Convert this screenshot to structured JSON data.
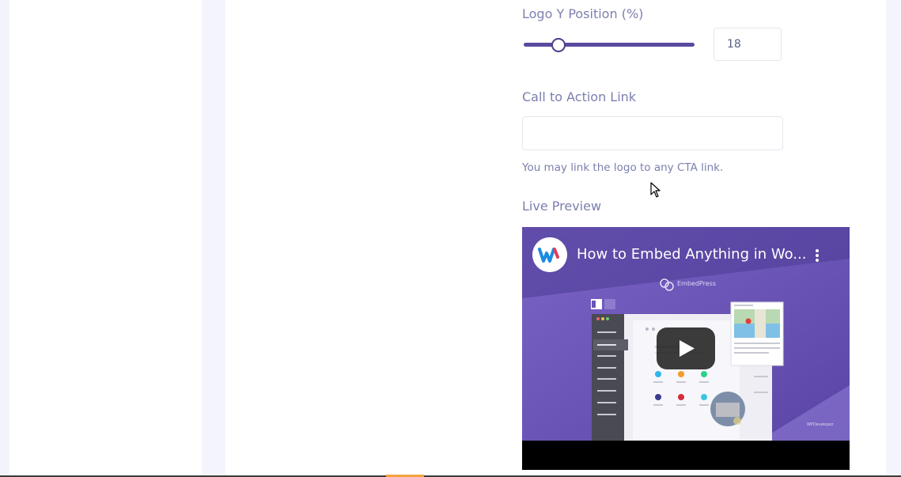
{
  "logo_y": {
    "label": "Logo Y Position (%)",
    "value": "18",
    "slider_fraction": 0.18
  },
  "cta": {
    "label": "Call to Action Link",
    "value": "",
    "hint": "You may link the logo to any CTA link."
  },
  "preview": {
    "label": "Live Preview",
    "video_title": "How to Embed Anything in Wo...",
    "brand_text": "EmbedPress",
    "footer_brand": "WPDeveloper"
  },
  "colors": {
    "label_text": "#7c7fae",
    "slider": "#5b4a9e",
    "video_bg": "#6a55b7"
  }
}
